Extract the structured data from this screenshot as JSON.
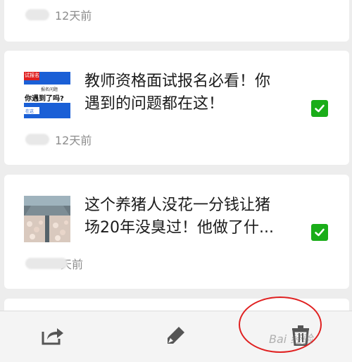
{
  "items": [
    {
      "time": "12天前"
    },
    {
      "title_line1": "教师资格面试报名必看！你",
      "title_line2": "遇到的问题都在这！",
      "time": "12天前",
      "thumb_text1": "试报名",
      "thumb_text2": "你遇到了吗?",
      "thumb_text3": "报名问题",
      "thumb_text4": "在这"
    },
    {
      "title_line1": "这个养猪人没花一分钱让猪",
      "title_line2": "场20年没臭过！他做了什...",
      "time": "天前"
    }
  ],
  "toolbar": {
    "share_icon": "share-icon",
    "edit_icon": "edit-tag-icon",
    "delete_icon": "trash-icon"
  },
  "watermark": "Bai 经验",
  "colors": {
    "check": "#1aad19",
    "annotation": "#e02020",
    "thumb_blue": "#1a5fd6"
  }
}
